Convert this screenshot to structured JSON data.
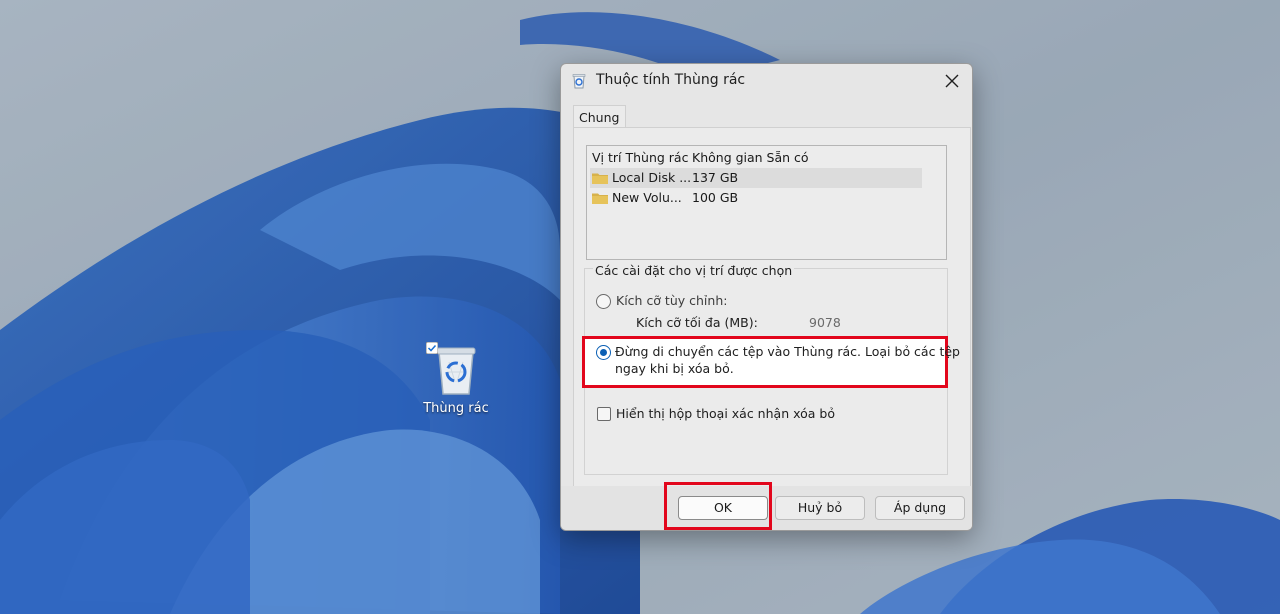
{
  "desktop": {
    "icon_label": "Thùng rác"
  },
  "dialog": {
    "title": "Thuộc tính Thùng rác",
    "tab": "Chung",
    "list": {
      "headers": [
        "Vị trí Thùng rác",
        "Không gian Sẵn có"
      ],
      "rows": [
        {
          "location": "Local Disk ...",
          "space": "137 GB",
          "selected": true
        },
        {
          "location": "New Volu...",
          "space": "100 GB",
          "selected": false
        }
      ]
    },
    "settings": {
      "group_title": "Các cài đặt cho vị trí được chọn",
      "custom_size_label": "Kích cỡ tùy chỉnh:",
      "max_size_label": "Kích cỡ tối đa (MB):",
      "max_size_value": "9078",
      "dont_move_line1": "Đừng di chuyển các tệp vào Thùng rác. Loại bỏ các tệp",
      "dont_move_line2": "ngay khi bị xóa bỏ.",
      "confirm_label": "Hiển thị hộp thoại xác nhận xóa bỏ"
    },
    "buttons": {
      "ok": "OK",
      "cancel": "Huỷ bỏ",
      "apply": "Áp dụng"
    }
  },
  "colors": {
    "highlight": "#e2061c",
    "accent": "#0a5fb4"
  }
}
